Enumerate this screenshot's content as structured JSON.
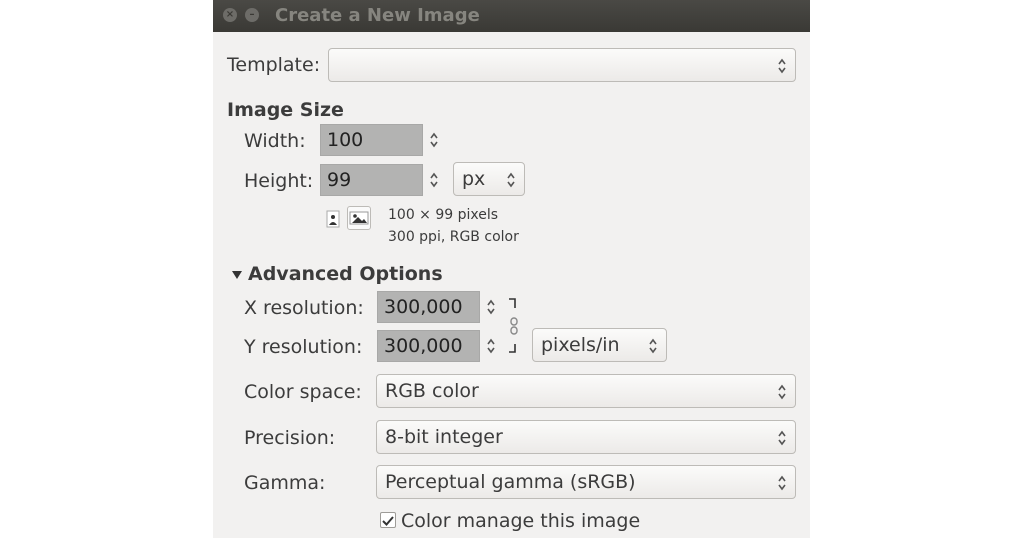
{
  "window": {
    "title": "Create a New Image"
  },
  "template": {
    "label": "Template:",
    "value": ""
  },
  "image_size": {
    "heading": "Image Size",
    "width_label": "Width:",
    "width_value": "100",
    "height_label": "Height:",
    "height_value": "99",
    "unit": "px",
    "info_line1": "100 × 99 pixels",
    "info_line2": "300 ppi, RGB color"
  },
  "advanced": {
    "heading": "Advanced Options",
    "x_res_label": "X resolution:",
    "x_res_value": "300,000",
    "y_res_label": "Y resolution:",
    "y_res_value": "300,000",
    "res_unit": "pixels/in",
    "color_space_label": "Color space:",
    "color_space_value": "RGB color",
    "precision_label": "Precision:",
    "precision_value": "8-bit integer",
    "gamma_label": "Gamma:",
    "gamma_value": "Perceptual gamma (sRGB)",
    "color_manage_label": "Color manage this image",
    "color_manage_checked": true
  },
  "icons": [
    "close-icon",
    "minimize-icon",
    "spin-arrows-icon",
    "portrait-icon",
    "landscape-icon",
    "chain-link-icon",
    "expander-arrow-icon",
    "checkmark-icon"
  ]
}
